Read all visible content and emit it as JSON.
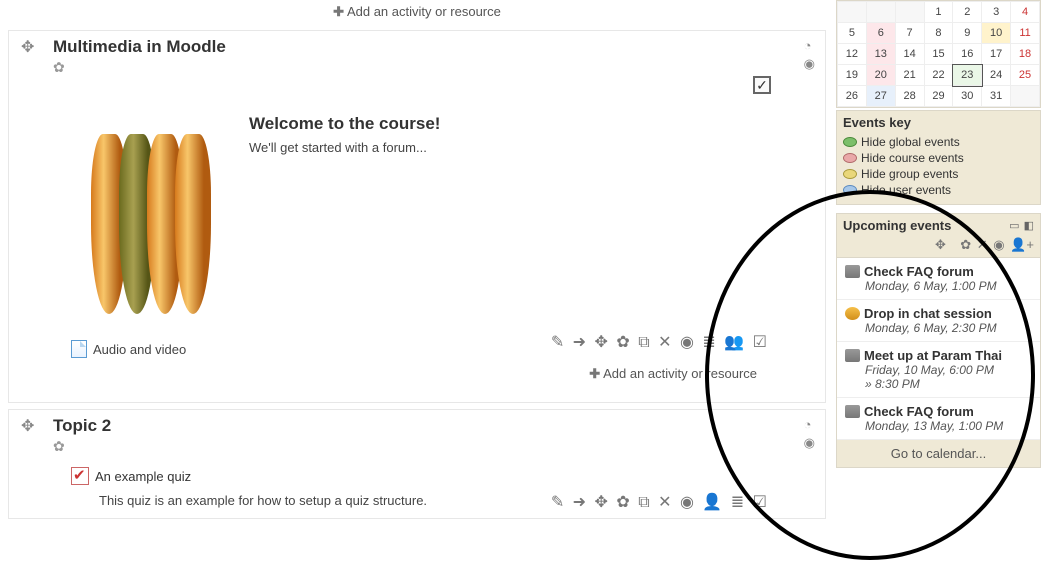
{
  "add_resource_label": "Add an activity or resource",
  "section1": {
    "title": "Multimedia in Moodle",
    "welcome_heading": "Welcome to the course!",
    "welcome_sub": "We'll get started with a forum...",
    "resource_label": "Audio and video"
  },
  "section2": {
    "title": "Topic 2",
    "quiz_label": "An example quiz",
    "quiz_desc": "This quiz is an example for how to setup a quiz structure."
  },
  "calendar": {
    "rows": [
      [
        "",
        "",
        "",
        "1",
        "2",
        "3",
        "4"
      ],
      [
        "5",
        "6",
        "7",
        "8",
        "9",
        "10",
        "11"
      ],
      [
        "12",
        "13",
        "14",
        "15",
        "16",
        "17",
        "18"
      ],
      [
        "19",
        "20",
        "21",
        "22",
        "23",
        "24",
        "25"
      ],
      [
        "26",
        "27",
        "28",
        "29",
        "30",
        "31",
        ""
      ]
    ]
  },
  "events_key": {
    "heading": "Events key",
    "global": "Hide global events",
    "course": "Hide course events",
    "group": "Hide group events",
    "user": "Hide user events"
  },
  "upcoming": {
    "heading": "Upcoming events",
    "events": [
      {
        "title": "Check FAQ forum",
        "date": "Monday, 6 May, 1:00 PM",
        "icon": "grp",
        "extra": ""
      },
      {
        "title": "Drop in chat session",
        "date": "Monday, 6 May, 2:30 PM",
        "icon": "chat",
        "extra": ""
      },
      {
        "title": "Meet up at Param Thai",
        "date": "Friday, 10 May, 6:00 PM",
        "icon": "grp",
        "extra": "» 8:30 PM"
      },
      {
        "title": "Check FAQ forum",
        "date": "Monday, 13 May, 1:00 PM",
        "icon": "grp",
        "extra": ""
      }
    ],
    "go_calendar": "Go to calendar..."
  }
}
